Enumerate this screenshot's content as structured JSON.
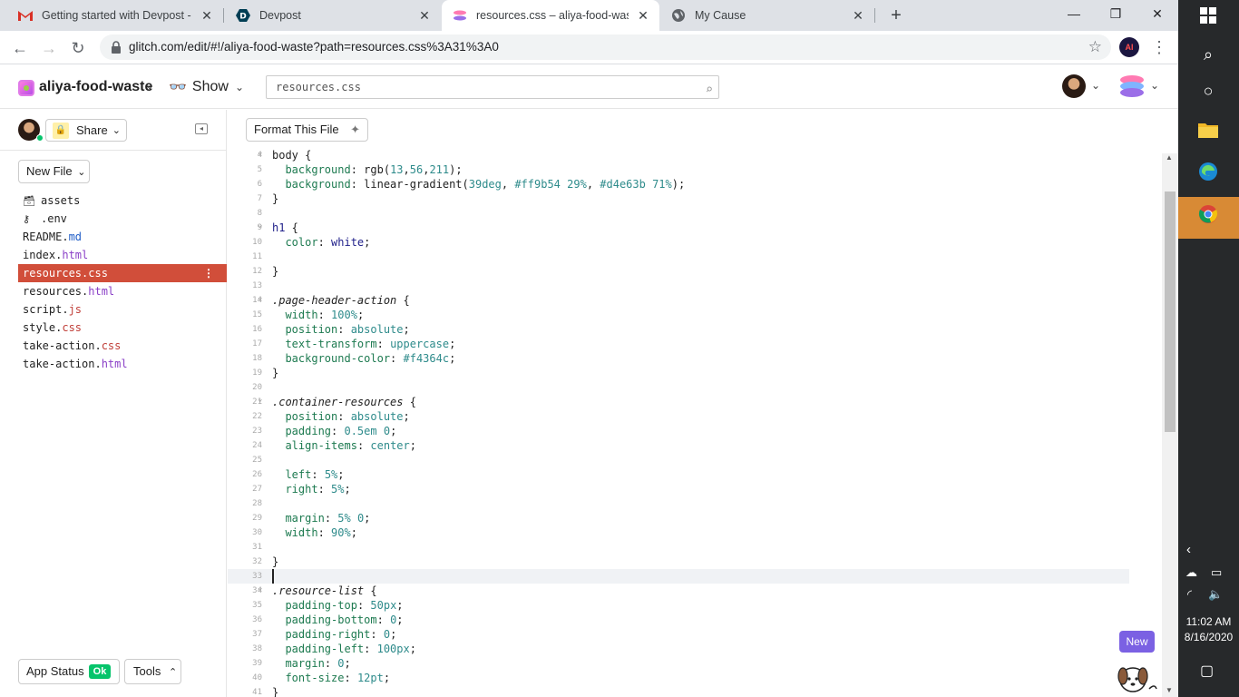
{
  "browser": {
    "tabs": [
      {
        "title": "Getting started with Devpost - pu",
        "icon": "gmail-icon",
        "active": false
      },
      {
        "title": "Devpost",
        "icon": "devpost-icon",
        "active": false
      },
      {
        "title": "resources.css – aliya-food-waste",
        "icon": "glitch-icon",
        "active": true
      },
      {
        "title": "My Cause",
        "icon": "globe-icon",
        "active": false
      }
    ],
    "url": "glitch.com/edit/#!/aliya-food-waste?path=resources.css%3A31%3A0",
    "profile_initials": "AI"
  },
  "glitch": {
    "project_name": "aliya-food-waste",
    "show_label": "Show",
    "search_placeholder": "resources.css",
    "share_label": "Share",
    "new_file_label": "New File",
    "format_label": "Format This File",
    "app_status_label": "App Status",
    "app_status_badge": "Ok",
    "tools_label": "Tools",
    "new_badge": "New"
  },
  "files": [
    {
      "name": "assets",
      "ext": "",
      "icon": "folder-icon"
    },
    {
      "name": ".env",
      "ext": "",
      "icon": "key-icon"
    },
    {
      "name": "README.",
      "ext": "md",
      "icon": ""
    },
    {
      "name": "index.",
      "ext": "html",
      "icon": ""
    },
    {
      "name": "resources.",
      "ext": "css",
      "icon": "",
      "active": true
    },
    {
      "name": "resources.",
      "ext": "html",
      "icon": ""
    },
    {
      "name": "script.",
      "ext": "js",
      "icon": ""
    },
    {
      "name": "style.",
      "ext": "css",
      "icon": ""
    },
    {
      "name": "take-action.",
      "ext": "css",
      "icon": ""
    },
    {
      "name": "take-action.",
      "ext": "html",
      "icon": ""
    }
  ],
  "code_lines": [
    {
      "n": "4",
      "fold": true,
      "parts": [
        [
          "sel",
          "body"
        ],
        [
          "punc",
          " {"
        ]
      ]
    },
    {
      "n": "5",
      "parts": [
        [
          "punc",
          "  "
        ],
        [
          "prop",
          "background"
        ],
        [
          "punc",
          ": rgb("
        ],
        [
          "val",
          "13"
        ],
        [
          "punc",
          ","
        ],
        [
          "val",
          "56"
        ],
        [
          "punc",
          ","
        ],
        [
          "val",
          "211"
        ],
        [
          "punc",
          ");"
        ]
      ]
    },
    {
      "n": "6",
      "parts": [
        [
          "punc",
          "  "
        ],
        [
          "prop",
          "background"
        ],
        [
          "punc",
          ": linear-gradient("
        ],
        [
          "val",
          "39deg"
        ],
        [
          "punc",
          ", "
        ],
        [
          "val",
          "#ff9b54 29%"
        ],
        [
          "punc",
          ", "
        ],
        [
          "val",
          "#d4e63b 71%"
        ],
        [
          "punc",
          ");"
        ]
      ]
    },
    {
      "n": "7",
      "parts": [
        [
          "punc",
          "}"
        ]
      ]
    },
    {
      "n": "8",
      "parts": []
    },
    {
      "n": "9",
      "fold": true,
      "parts": [
        [
          "kw",
          "h1"
        ],
        [
          "punc",
          " {"
        ]
      ]
    },
    {
      "n": "10",
      "parts": [
        [
          "punc",
          "  "
        ],
        [
          "prop",
          "color"
        ],
        [
          "punc",
          ": "
        ],
        [
          "kw",
          "white"
        ],
        [
          "punc",
          ";"
        ]
      ]
    },
    {
      "n": "11",
      "parts": []
    },
    {
      "n": "12",
      "parts": [
        [
          "punc",
          "}"
        ]
      ]
    },
    {
      "n": "13",
      "parts": []
    },
    {
      "n": "14",
      "fold": true,
      "parts": [
        [
          "cls",
          ".page-header-action"
        ],
        [
          "punc",
          " {"
        ]
      ]
    },
    {
      "n": "15",
      "parts": [
        [
          "punc",
          "  "
        ],
        [
          "prop",
          "width"
        ],
        [
          "punc",
          ": "
        ],
        [
          "val",
          "100%"
        ],
        [
          "punc",
          ";"
        ]
      ]
    },
    {
      "n": "16",
      "parts": [
        [
          "punc",
          "  "
        ],
        [
          "prop",
          "position"
        ],
        [
          "punc",
          ": "
        ],
        [
          "val",
          "absolute"
        ],
        [
          "punc",
          ";"
        ]
      ]
    },
    {
      "n": "17",
      "parts": [
        [
          "punc",
          "  "
        ],
        [
          "prop",
          "text-transform"
        ],
        [
          "punc",
          ": "
        ],
        [
          "val",
          "uppercase"
        ],
        [
          "punc",
          ";"
        ]
      ]
    },
    {
      "n": "18",
      "parts": [
        [
          "punc",
          "  "
        ],
        [
          "prop",
          "background-color"
        ],
        [
          "punc",
          ": "
        ],
        [
          "val",
          "#f4364c"
        ],
        [
          "punc",
          ";"
        ]
      ]
    },
    {
      "n": "19",
      "parts": [
        [
          "punc",
          "}"
        ]
      ]
    },
    {
      "n": "20",
      "parts": []
    },
    {
      "n": "21",
      "fold": true,
      "parts": [
        [
          "cls",
          ".container-resources"
        ],
        [
          "punc",
          " {"
        ]
      ]
    },
    {
      "n": "22",
      "parts": [
        [
          "punc",
          "  "
        ],
        [
          "prop",
          "position"
        ],
        [
          "punc",
          ": "
        ],
        [
          "val",
          "absolute"
        ],
        [
          "punc",
          ";"
        ]
      ]
    },
    {
      "n": "23",
      "parts": [
        [
          "punc",
          "  "
        ],
        [
          "prop",
          "padding"
        ],
        [
          "punc",
          ": "
        ],
        [
          "val",
          "0.5em 0"
        ],
        [
          "punc",
          ";"
        ]
      ]
    },
    {
      "n": "24",
      "parts": [
        [
          "punc",
          "  "
        ],
        [
          "prop",
          "align-items"
        ],
        [
          "punc",
          ": "
        ],
        [
          "val",
          "center"
        ],
        [
          "punc",
          ";"
        ]
      ]
    },
    {
      "n": "25",
      "parts": []
    },
    {
      "n": "26",
      "parts": [
        [
          "punc",
          "  "
        ],
        [
          "prop",
          "left"
        ],
        [
          "punc",
          ": "
        ],
        [
          "val",
          "5%"
        ],
        [
          "punc",
          ";"
        ]
      ]
    },
    {
      "n": "27",
      "parts": [
        [
          "punc",
          "  "
        ],
        [
          "prop",
          "right"
        ],
        [
          "punc",
          ": "
        ],
        [
          "val",
          "5%"
        ],
        [
          "punc",
          ";"
        ]
      ]
    },
    {
      "n": "28",
      "parts": []
    },
    {
      "n": "29",
      "parts": [
        [
          "punc",
          "  "
        ],
        [
          "prop",
          "margin"
        ],
        [
          "punc",
          ": "
        ],
        [
          "val",
          "5% 0"
        ],
        [
          "punc",
          ";"
        ]
      ]
    },
    {
      "n": "30",
      "parts": [
        [
          "punc",
          "  "
        ],
        [
          "prop",
          "width"
        ],
        [
          "punc",
          ": "
        ],
        [
          "val",
          "90%"
        ],
        [
          "punc",
          ";"
        ]
      ]
    },
    {
      "n": "31",
      "parts": []
    },
    {
      "n": "32",
      "parts": [
        [
          "punc",
          "}"
        ]
      ]
    },
    {
      "n": "33",
      "current": true,
      "parts": []
    },
    {
      "n": "34",
      "fold": true,
      "parts": [
        [
          "cls",
          ".resource-list"
        ],
        [
          "punc",
          " {"
        ]
      ]
    },
    {
      "n": "35",
      "parts": [
        [
          "punc",
          "  "
        ],
        [
          "prop",
          "padding-top"
        ],
        [
          "punc",
          ": "
        ],
        [
          "val",
          "50px"
        ],
        [
          "punc",
          ";"
        ]
      ]
    },
    {
      "n": "36",
      "parts": [
        [
          "punc",
          "  "
        ],
        [
          "prop",
          "padding-bottom"
        ],
        [
          "punc",
          ": "
        ],
        [
          "val",
          "0"
        ],
        [
          "punc",
          ";"
        ]
      ]
    },
    {
      "n": "37",
      "parts": [
        [
          "punc",
          "  "
        ],
        [
          "prop",
          "padding-right"
        ],
        [
          "punc",
          ": "
        ],
        [
          "val",
          "0"
        ],
        [
          "punc",
          ";"
        ]
      ]
    },
    {
      "n": "38",
      "parts": [
        [
          "punc",
          "  "
        ],
        [
          "prop",
          "padding-left"
        ],
        [
          "punc",
          ": "
        ],
        [
          "val",
          "100px"
        ],
        [
          "punc",
          ";"
        ]
      ]
    },
    {
      "n": "39",
      "parts": [
        [
          "punc",
          "  "
        ],
        [
          "prop",
          "margin"
        ],
        [
          "punc",
          ": "
        ],
        [
          "val",
          "0"
        ],
        [
          "punc",
          ";"
        ]
      ]
    },
    {
      "n": "40",
      "parts": [
        [
          "punc",
          "  "
        ],
        [
          "prop",
          "font-size"
        ],
        [
          "punc",
          ": "
        ],
        [
          "val",
          "12pt"
        ],
        [
          "punc",
          ";"
        ]
      ]
    },
    {
      "n": "41",
      "parts": [
        [
          "punc",
          "}"
        ]
      ]
    }
  ],
  "taskbar": {
    "time": "11:02 AM",
    "date": "8/16/2020"
  },
  "colors": {
    "active_file": "#d14e3a",
    "status_ok": "#05c46b",
    "new_badge": "#7b61e3",
    "chrome_highlight": "#d88a35"
  }
}
